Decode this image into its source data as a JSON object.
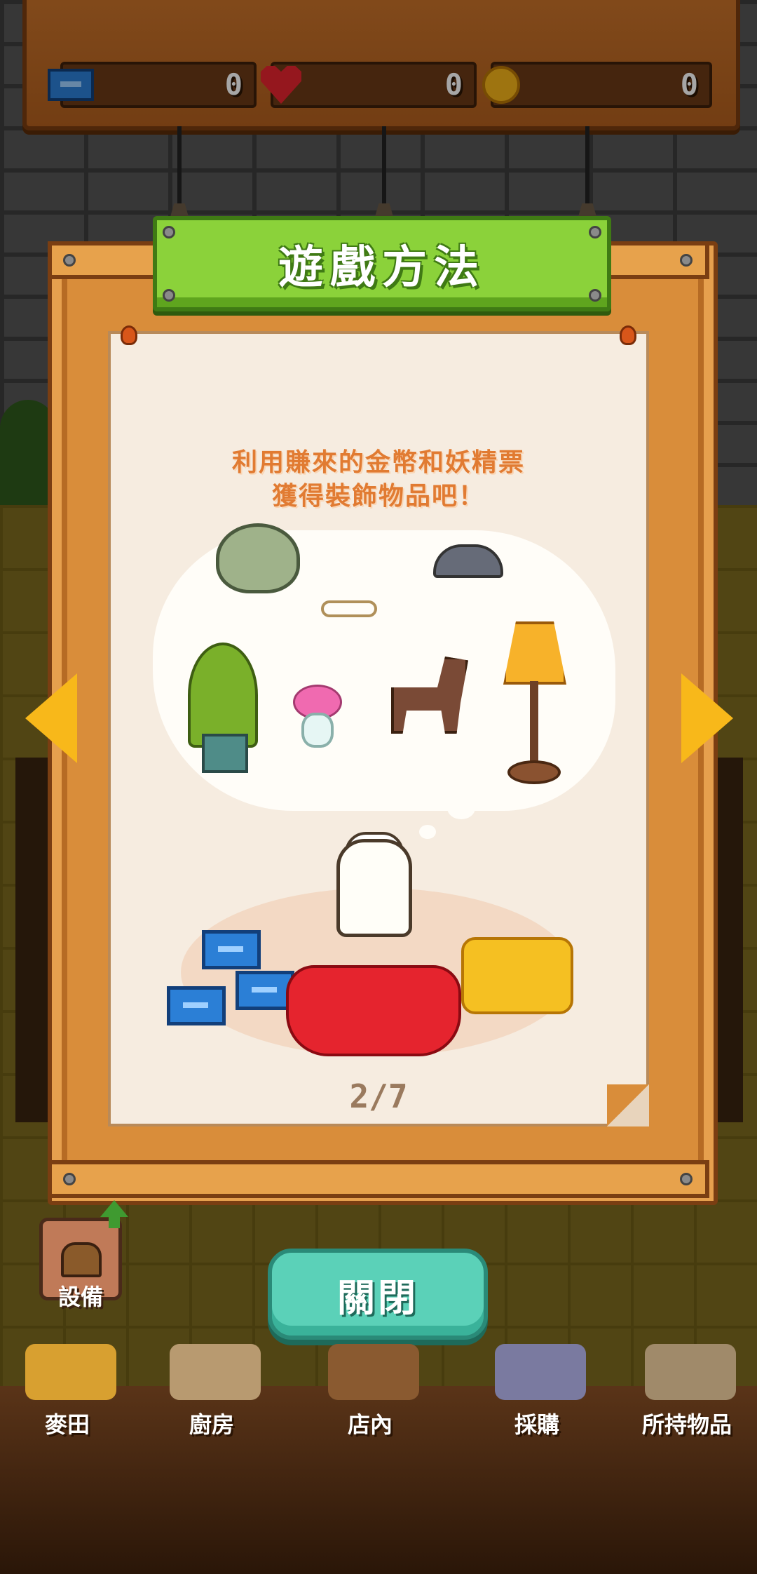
{
  "currency": {
    "tickets": "0",
    "hearts": "0",
    "coins": "0"
  },
  "modal": {
    "title": "遊戲方法",
    "caption_line1": "利用賺來的金幣和妖精票",
    "caption_line2": "獲得裝飾物品吧！",
    "page_indicator": "2/7",
    "close_label": "關閉"
  },
  "equipment": {
    "label": "設備"
  },
  "nav": {
    "items": [
      {
        "label": "麥田"
      },
      {
        "label": "廚房"
      },
      {
        "label": "店內"
      },
      {
        "label": "採購"
      },
      {
        "label": "所持物品"
      }
    ]
  },
  "colors": {
    "title_green": "#8bd23a",
    "caption_orange": "#e17b32",
    "close_teal": "#5bd1b8",
    "arrow_yellow": "#f8b81a"
  }
}
